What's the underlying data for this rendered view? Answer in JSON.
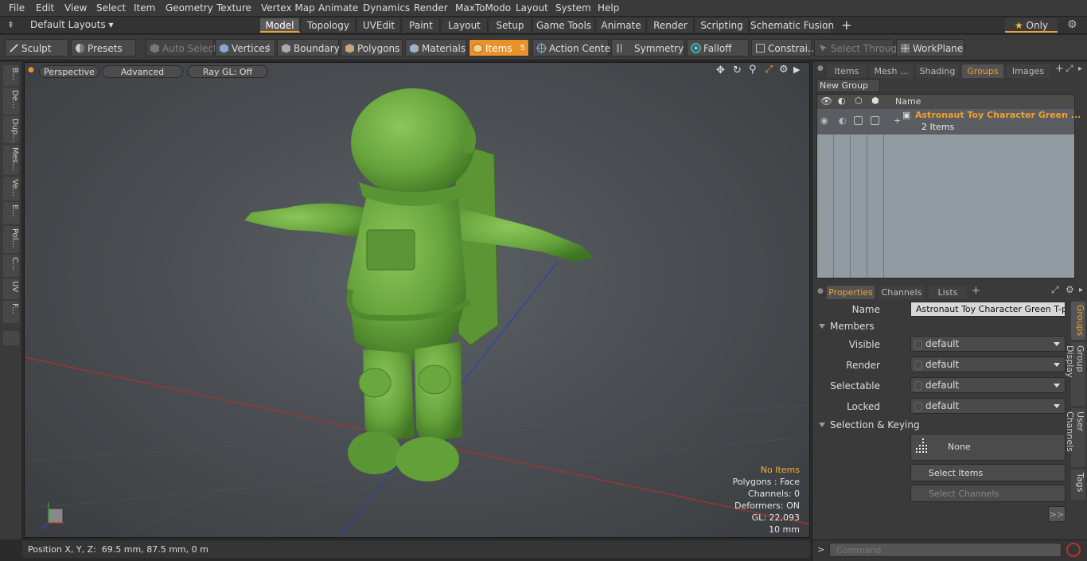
{
  "menu": [
    "File",
    "Edit",
    "View",
    "Select",
    "Item",
    "Geometry",
    "Texture",
    "Vertex Map",
    "Animate",
    "Dynamics",
    "Render",
    "MaxToModo",
    "Layout",
    "System",
    "Help"
  ],
  "layouts": {
    "dropdown": "Default Layouts",
    "tabs": [
      "Model",
      "Topology",
      "UVEdit",
      "Paint",
      "Layout",
      "Setup",
      "Game Tools",
      "Animate",
      "Render",
      "Scripting",
      "Schematic Fusion"
    ],
    "active_tab": "Model",
    "only_label": "Only"
  },
  "toolbar": {
    "sculpt": "Sculpt",
    "presets": "Presets",
    "auto_select": "Auto Select",
    "vertices": "Vertices",
    "vertices_count": "1",
    "boundary": "Boundary",
    "polygons": "Polygons",
    "materials": "Materials",
    "items": "Items",
    "items_count": "5",
    "action_center": "Action Center",
    "symmetry": "Symmetry",
    "falloff": "Falloff",
    "constraints": "Constrai...",
    "select_through": "Select Through",
    "workplane": "WorkPlane"
  },
  "left_tabs": [
    "B...",
    "De...",
    "Dup...",
    "Mes...",
    "Ve...",
    "E...",
    "Pol...",
    "C...",
    "UV",
    "F..."
  ],
  "viewport": {
    "view_mode": "Perspective",
    "shading": "Advanced",
    "raygl": "Ray GL: Off",
    "stats": {
      "items": "No Items",
      "polygons": "Polygons : Face",
      "channels": "Channels: 0",
      "deformers": "Deformers: ON",
      "gl": "GL: 22,093",
      "scale": "10 mm"
    }
  },
  "status": {
    "position": "Position X, Y, Z:  69.5 mm, 87.5 mm, 0 m"
  },
  "groups_panel": {
    "tabs": [
      "Items",
      "Mesh ...",
      "Shading",
      "Groups",
      "Images"
    ],
    "active_tab": "Groups",
    "new_group": "New Group",
    "name_header": "Name",
    "group_name": "Astronaut Toy Character Green ...",
    "group_count": "2 Items"
  },
  "properties": {
    "tabs": [
      "Properties",
      "Channels",
      "Lists"
    ],
    "active_tab": "Properties",
    "name_label": "Name",
    "name_value": "Astronaut Toy Character Green T-pose",
    "members": "Members",
    "visible_label": "Visible",
    "visible_value": "default",
    "render_label": "Render",
    "render_value": "default",
    "selectable_label": "Selectable",
    "selectable_value": "default",
    "locked_label": "Locked",
    "locked_value": "default",
    "sel_keying": "Selection & Keying",
    "none_btn": "None",
    "select_items": "Select Items",
    "select_channels": "Select Channels",
    "more": ">>",
    "side_tabs": [
      "Groups",
      "Group Display",
      "User Channels",
      "Tags"
    ]
  },
  "command": {
    "prompt": ">",
    "placeholder": "Command"
  },
  "colors": {
    "accent": "#f0a030",
    "model_green": "#6fae45"
  }
}
